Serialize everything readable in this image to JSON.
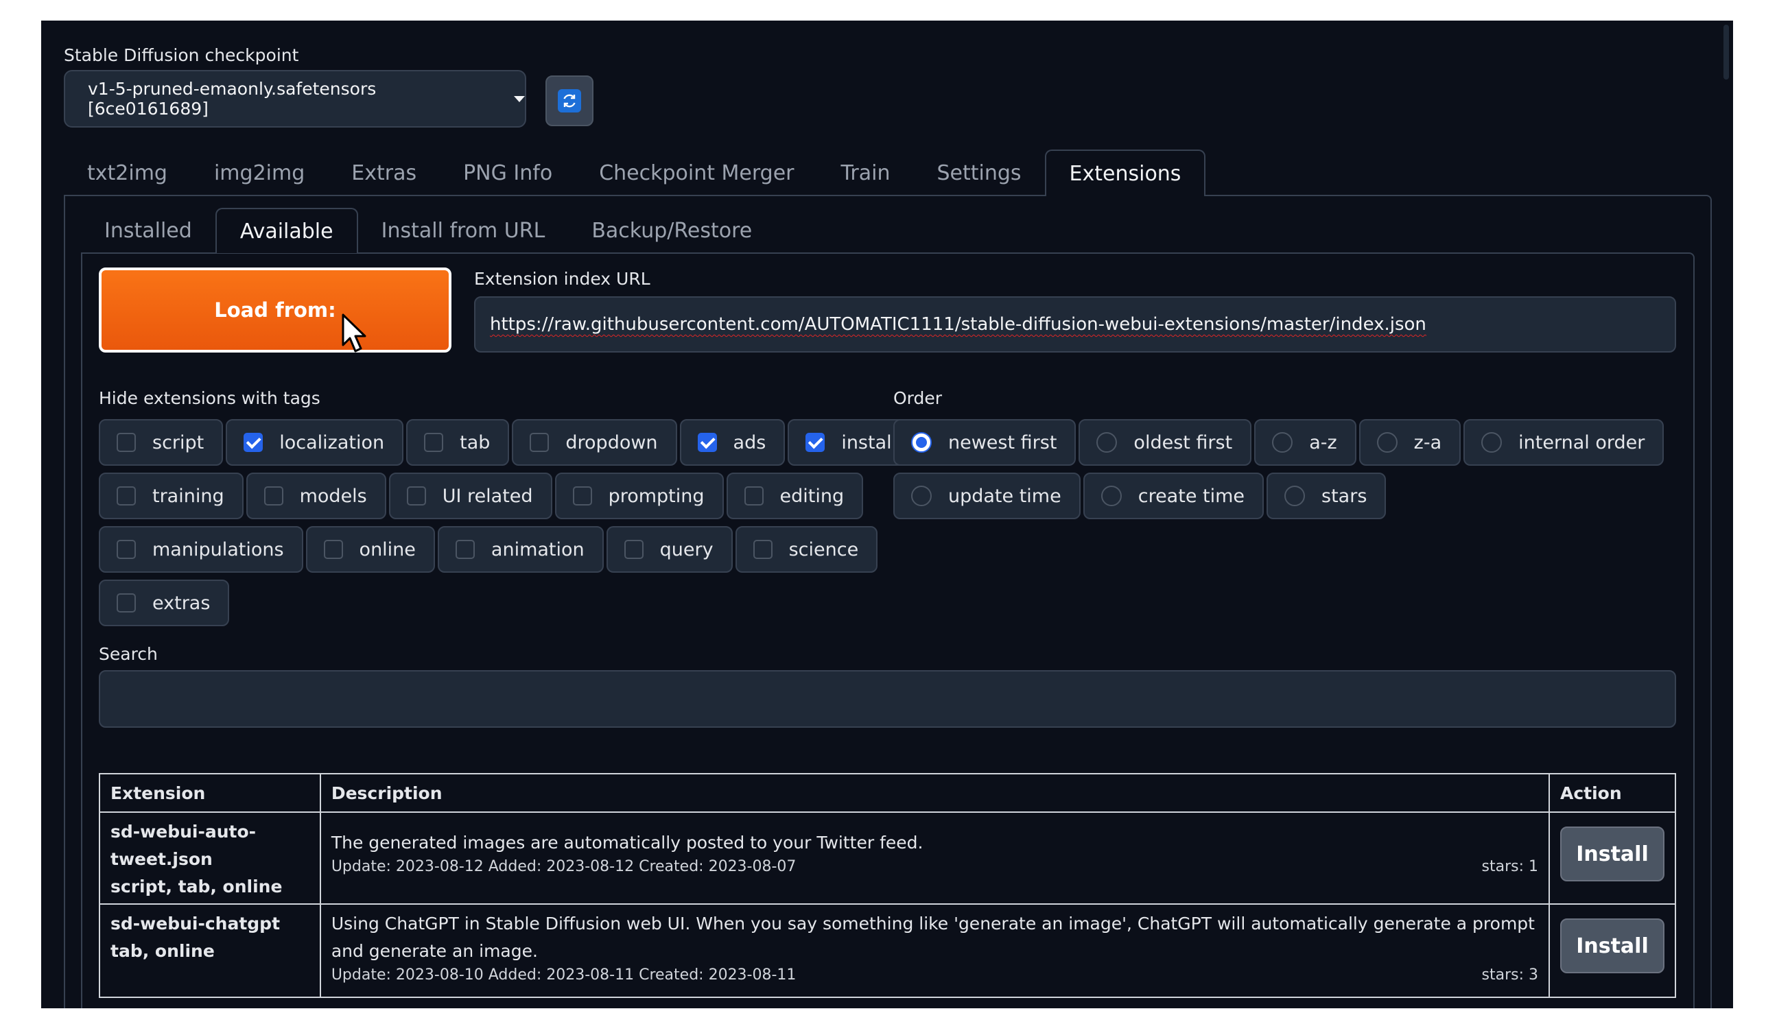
{
  "checkpoint": {
    "label": "Stable Diffusion checkpoint",
    "value": "v1-5-pruned-emaonly.safetensors [6ce0161689]",
    "refresh_icon": "refresh-icon"
  },
  "main_tabs": [
    "txt2img",
    "img2img",
    "Extras",
    "PNG Info",
    "Checkpoint Merger",
    "Train",
    "Settings",
    "Extensions"
  ],
  "main_tabs_active": "Extensions",
  "sub_tabs": [
    "Installed",
    "Available",
    "Install from URL",
    "Backup/Restore"
  ],
  "sub_tabs_active": "Available",
  "load_button": "Load from:",
  "index_url": {
    "label": "Extension index URL",
    "value": "https://raw.githubusercontent.com/AUTOMATIC1111/stable-diffusion-webui-extensions/master/index.json"
  },
  "hide_tags": {
    "label": "Hide extensions with tags",
    "rows": [
      [
        {
          "label": "script",
          "checked": false
        },
        {
          "label": "localization",
          "checked": true
        },
        {
          "label": "tab",
          "checked": false
        },
        {
          "label": "dropdown",
          "checked": false
        },
        {
          "label": "ads",
          "checked": true
        },
        {
          "label": "installed",
          "checked": true
        }
      ],
      [
        {
          "label": "training",
          "checked": false
        },
        {
          "label": "models",
          "checked": false
        },
        {
          "label": "UI related",
          "checked": false
        },
        {
          "label": "prompting",
          "checked": false
        },
        {
          "label": "editing",
          "checked": false
        }
      ],
      [
        {
          "label": "manipulations",
          "checked": false
        },
        {
          "label": "online",
          "checked": false
        },
        {
          "label": "animation",
          "checked": false
        },
        {
          "label": "query",
          "checked": false
        },
        {
          "label": "science",
          "checked": false
        }
      ],
      [
        {
          "label": "extras",
          "checked": false
        }
      ]
    ]
  },
  "order": {
    "label": "Order",
    "rows": [
      [
        {
          "label": "newest first",
          "selected": true
        },
        {
          "label": "oldest first",
          "selected": false
        },
        {
          "label": "a-z",
          "selected": false
        },
        {
          "label": "z-a",
          "selected": false
        },
        {
          "label": "internal order",
          "selected": false
        }
      ],
      [
        {
          "label": "update time",
          "selected": false
        },
        {
          "label": "create time",
          "selected": false
        },
        {
          "label": "stars",
          "selected": false
        }
      ]
    ]
  },
  "search": {
    "label": "Search",
    "value": ""
  },
  "table": {
    "headers": {
      "extension": "Extension",
      "description": "Description",
      "action": "Action"
    },
    "rows": [
      {
        "name_lines": [
          "sd-webui-auto-",
          "tweet.json"
        ],
        "tags": "script, tab, online",
        "description": "The generated images are automatically posted to your Twitter feed.",
        "meta": "Update: 2023-08-12 Added: 2023-08-12 Created: 2023-08-07",
        "stars": "stars: 1",
        "action": "Install"
      },
      {
        "name_lines": [
          "sd-webui-chatgpt"
        ],
        "tags": "tab, online",
        "description": "Using ChatGPT in Stable Diffusion web UI. When you say something like 'generate an image', ChatGPT will automatically generate a prompt and generate an image.",
        "meta": "Update: 2023-08-10 Added: 2023-08-11 Created: 2023-08-11",
        "stars": "stars: 3",
        "action": "Install"
      }
    ]
  }
}
